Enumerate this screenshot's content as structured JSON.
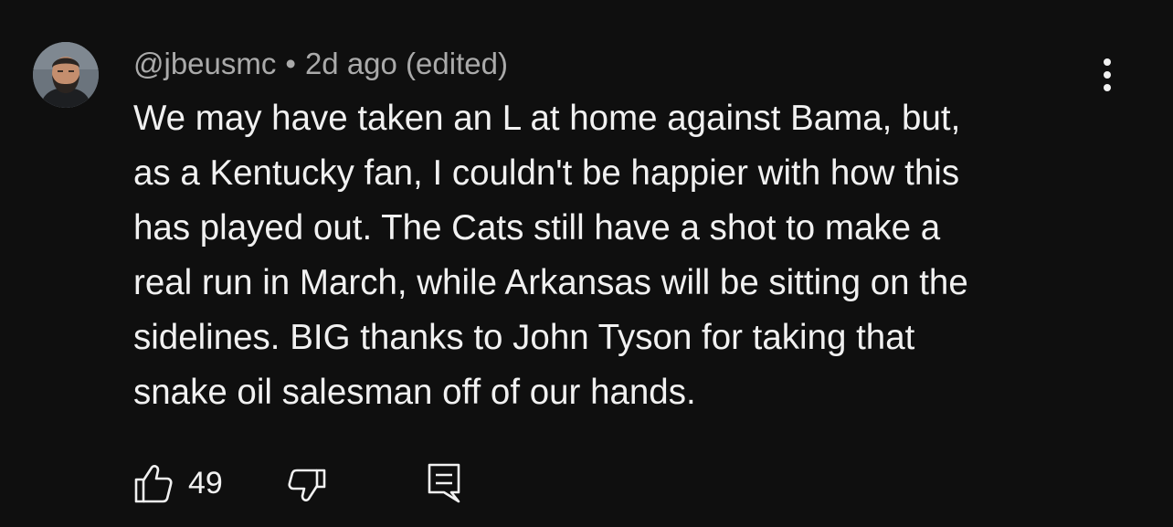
{
  "comment": {
    "author": "@jbeusmc",
    "separator": "•",
    "time": "2d ago (edited)",
    "text": "We may have taken an L at home against Bama, but,\nas a Kentucky fan, I couldn't be happier with how this\nhas played out. The Cats still have a shot to make a\nreal run in March, while Arkansas will be sitting on the\nsidelines. BIG thanks to John Tyson for taking that\nsnake oil salesman off of our hands.",
    "like_count": "49"
  },
  "icons": {
    "like": "thumbs-up-icon",
    "dislike": "thumbs-down-icon",
    "reply": "comment-icon",
    "menu": "more-vertical-icon"
  },
  "colors": {
    "background": "#0f0f0f",
    "primary_text": "#f1f1f1",
    "secondary_text": "#aaaaaa"
  }
}
